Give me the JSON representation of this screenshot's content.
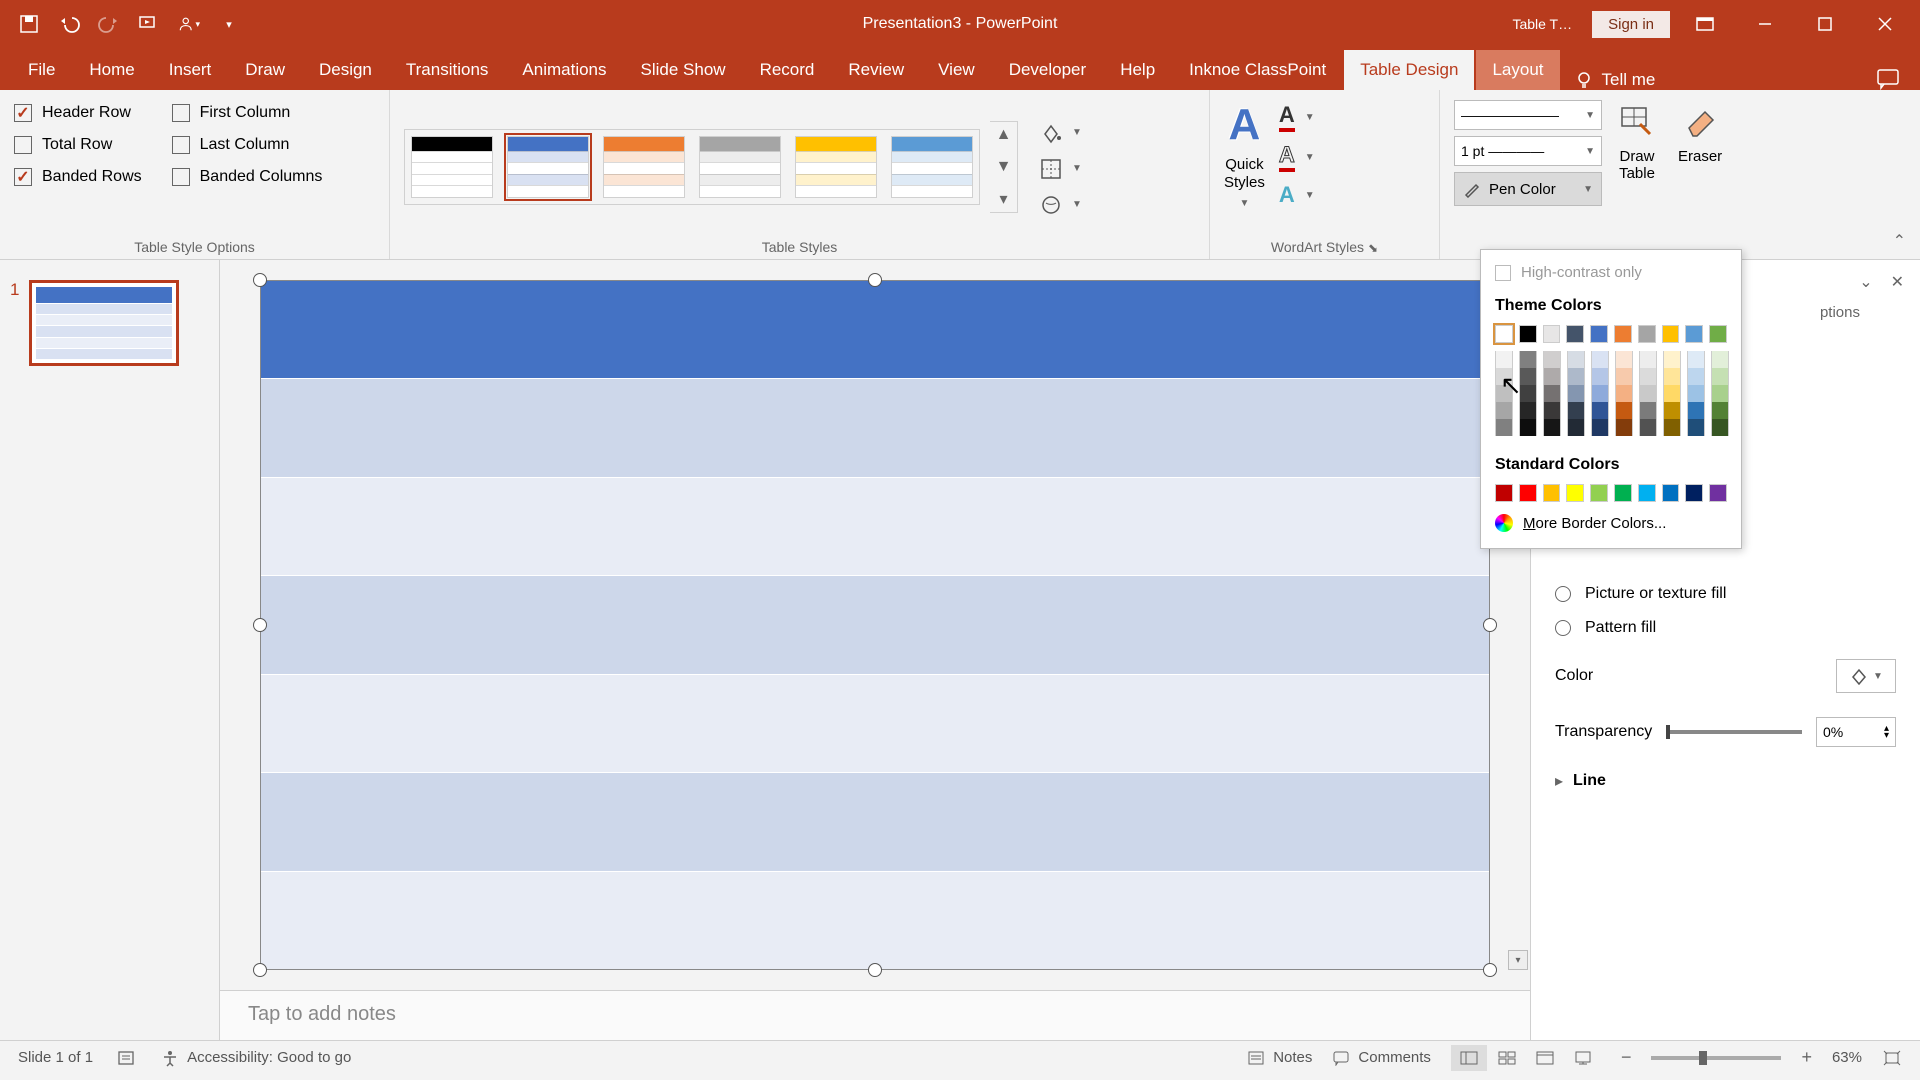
{
  "titlebar": {
    "title": "Presentation3  -  PowerPoint",
    "table_tools": "Table T…",
    "signin": "Sign in"
  },
  "ribbon_tabs": [
    "File",
    "Home",
    "Insert",
    "Draw",
    "Design",
    "Transitions",
    "Animations",
    "Slide Show",
    "Record",
    "Review",
    "View",
    "Developer",
    "Help",
    "Inknoe ClassPoint",
    "Table Design",
    "Layout"
  ],
  "tellme": "Tell me",
  "groups": {
    "tso": {
      "label": "Table Style Options",
      "options": {
        "header_row": {
          "label": "Header Row",
          "checked": true
        },
        "total_row": {
          "label": "Total Row",
          "checked": false
        },
        "banded_rows": {
          "label": "Banded Rows",
          "checked": true
        },
        "first_column": {
          "label": "First Column",
          "checked": false
        },
        "last_column": {
          "label": "Last Column",
          "checked": false
        },
        "banded_cols": {
          "label": "Banded Columns",
          "checked": false
        }
      }
    },
    "styles": {
      "label": "Table Styles"
    },
    "wordart": {
      "label": "WordArt Styles",
      "quick_styles": "Quick\nStyles"
    },
    "draw_borders": {
      "style_value": "———————",
      "weight_value": "1 pt ————",
      "pen_color": "Pen Color",
      "draw_table": "Draw\nTable",
      "eraser": "Eraser"
    }
  },
  "thumbnails": {
    "slide1_num": "1"
  },
  "notes_placeholder": "Tap to add notes",
  "format_pane": {
    "options_suffix": "ptions",
    "picture_fill": "Picture or texture fill",
    "pattern_fill": "Pattern fill",
    "color_label": "Color",
    "transparency_label": "Transparency",
    "transparency_value": "0%",
    "line_label": "Line"
  },
  "color_popup": {
    "high_contrast": "High-contrast only",
    "theme_heading": "Theme Colors",
    "standard_heading": "Standard Colors",
    "more_label": "More Border Colors...",
    "theme_main": [
      "#ffffff",
      "#000000",
      "#eeece1",
      "#1f497d",
      "#4f81bd",
      "#c0504d",
      "#9bbb59",
      "#8064a2",
      "#4bacc6",
      "#70ad47"
    ],
    "theme_main_overrides": [
      "#ffffff",
      "#000000",
      "#e7e6e6",
      "#44546a",
      "#4472c4",
      "#ed7d31",
      "#a5a5a5",
      "#ffc000",
      "#5b9bd5",
      "#70ad47"
    ],
    "theme_shades": [
      [
        "#f2f2f2",
        "#d9d9d9",
        "#bfbfbf",
        "#a6a6a6",
        "#808080"
      ],
      [
        "#808080",
        "#595959",
        "#404040",
        "#262626",
        "#0d0d0d"
      ],
      [
        "#d0cece",
        "#aeaaaa",
        "#757171",
        "#3a3838",
        "#161616"
      ],
      [
        "#d6dce4",
        "#adb9ca",
        "#8496b0",
        "#333f4f",
        "#222a35"
      ],
      [
        "#d9e2f3",
        "#b4c6e7",
        "#8eaadb",
        "#2f5496",
        "#1f3864"
      ],
      [
        "#fbe5d5",
        "#f7caac",
        "#f4b083",
        "#c55a11",
        "#833c0b"
      ],
      [
        "#ededed",
        "#dbdbdb",
        "#c9c9c9",
        "#7b7b7b",
        "#525252"
      ],
      [
        "#fff2cc",
        "#ffe599",
        "#ffd966",
        "#bf8f00",
        "#806000"
      ],
      [
        "#deeaf6",
        "#bdd6ee",
        "#9cc2e5",
        "#2e74b5",
        "#1f4e79"
      ],
      [
        "#e2efd9",
        "#c5e0b3",
        "#a8d08d",
        "#538135",
        "#375623"
      ]
    ],
    "standard": [
      "#c00000",
      "#ff0000",
      "#ffc000",
      "#ffff00",
      "#92d050",
      "#00b050",
      "#00b0f0",
      "#0070c0",
      "#002060",
      "#7030a0"
    ]
  },
  "statusbar": {
    "slide_of": "Slide 1 of 1",
    "accessibility": "Accessibility: Good to go",
    "notes": "Notes",
    "comments": "Comments",
    "zoom": "63%"
  },
  "table_style_thumbs": [
    {
      "head": "#000000",
      "row": "#ffffff",
      "border": "#000"
    },
    {
      "head": "#4472c4",
      "row": "#d9e1f2",
      "selected": true
    },
    {
      "head": "#ed7d31",
      "row": "#fbe5d5"
    },
    {
      "head": "#a5a5a5",
      "row": "#ededed"
    },
    {
      "head": "#ffc000",
      "row": "#fff2cc"
    },
    {
      "head": "#5b9bd5",
      "row": "#deeaf6"
    }
  ]
}
